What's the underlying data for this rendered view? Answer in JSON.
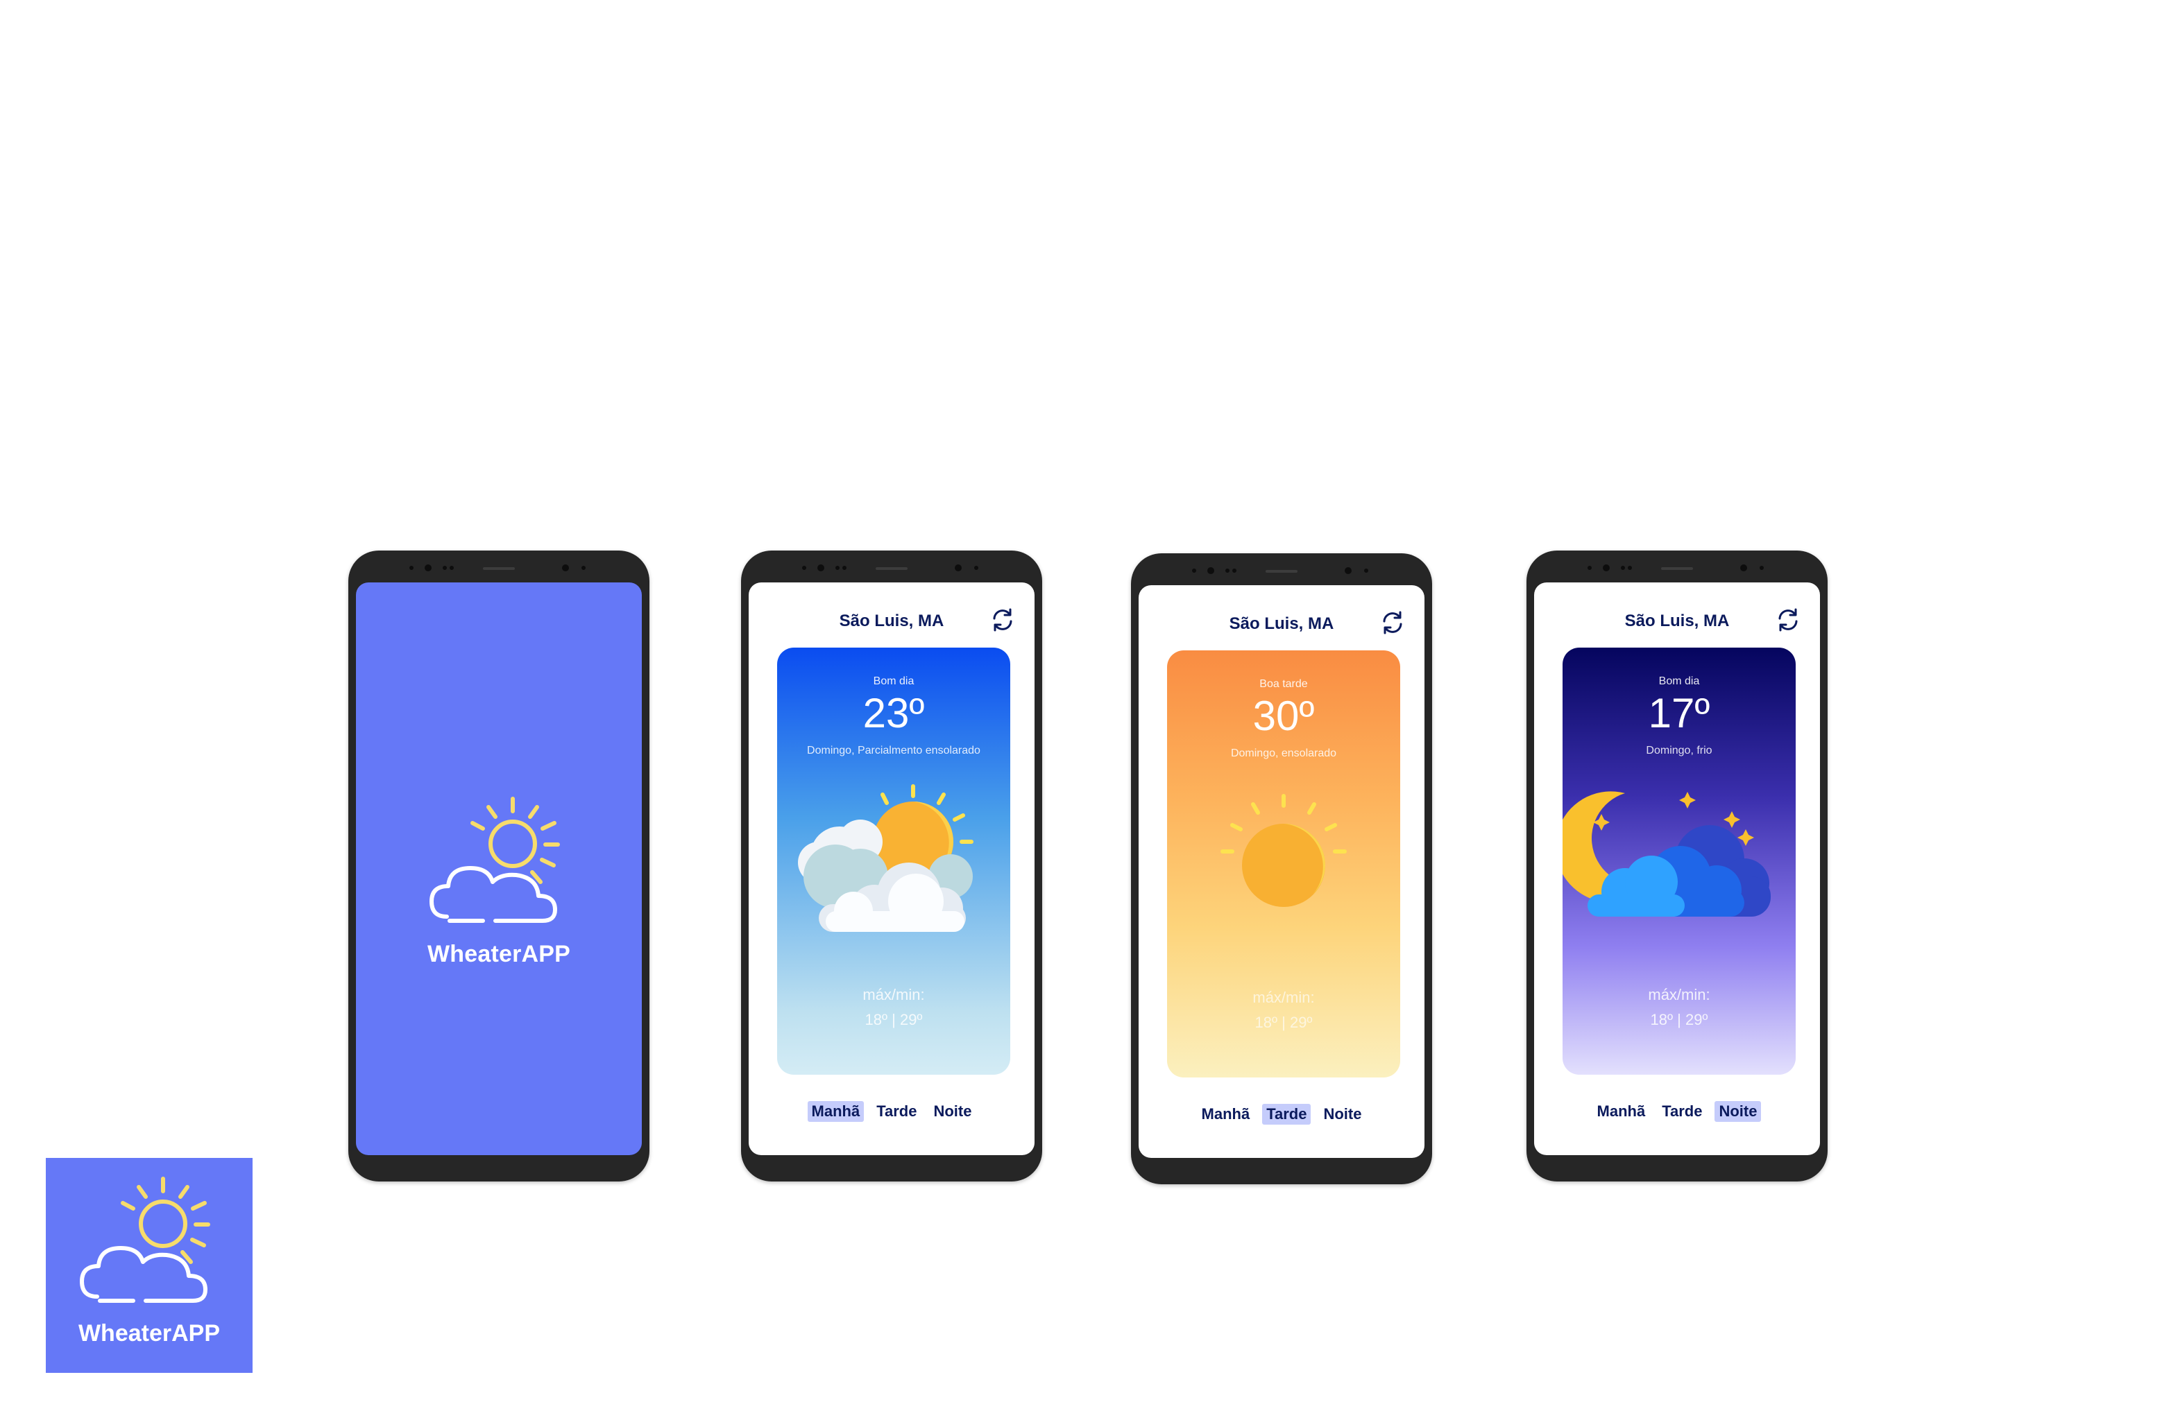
{
  "app": {
    "name": "WheaterAPP"
  },
  "screens": [
    {
      "city": "São Luis, MA",
      "greeting": "Bom dia",
      "temperature": "23º",
      "description": "Domingo, Parcialmento ensolarado",
      "minmax_label": "máx/min:",
      "minmax_value": "18º | 29º",
      "weather_icon": "partly-cloudy-icon",
      "active_tab": "Manhã"
    },
    {
      "city": "São Luis, MA",
      "greeting": "Boa tarde",
      "temperature": "30º",
      "description": "Domingo,  ensolarado",
      "minmax_label": "máx/min:",
      "minmax_value": "18º | 29º",
      "weather_icon": "sun-icon",
      "active_tab": "Tarde"
    },
    {
      "city": "São Luis, MA",
      "greeting": "Bom dia",
      "temperature": "17º",
      "description": "Domingo, frio",
      "minmax_label": "máx/min:",
      "minmax_value": "18º | 29º",
      "weather_icon": "moon-cloud-icon",
      "active_tab": "Noite"
    }
  ],
  "tabs": [
    "Manhã",
    "Tarde",
    "Noite"
  ],
  "colors": {
    "brand": "#6578f7",
    "text_dark": "#0b1a5c",
    "tab_highlight": "#c5ccfb",
    "phone_body": "#262626"
  }
}
